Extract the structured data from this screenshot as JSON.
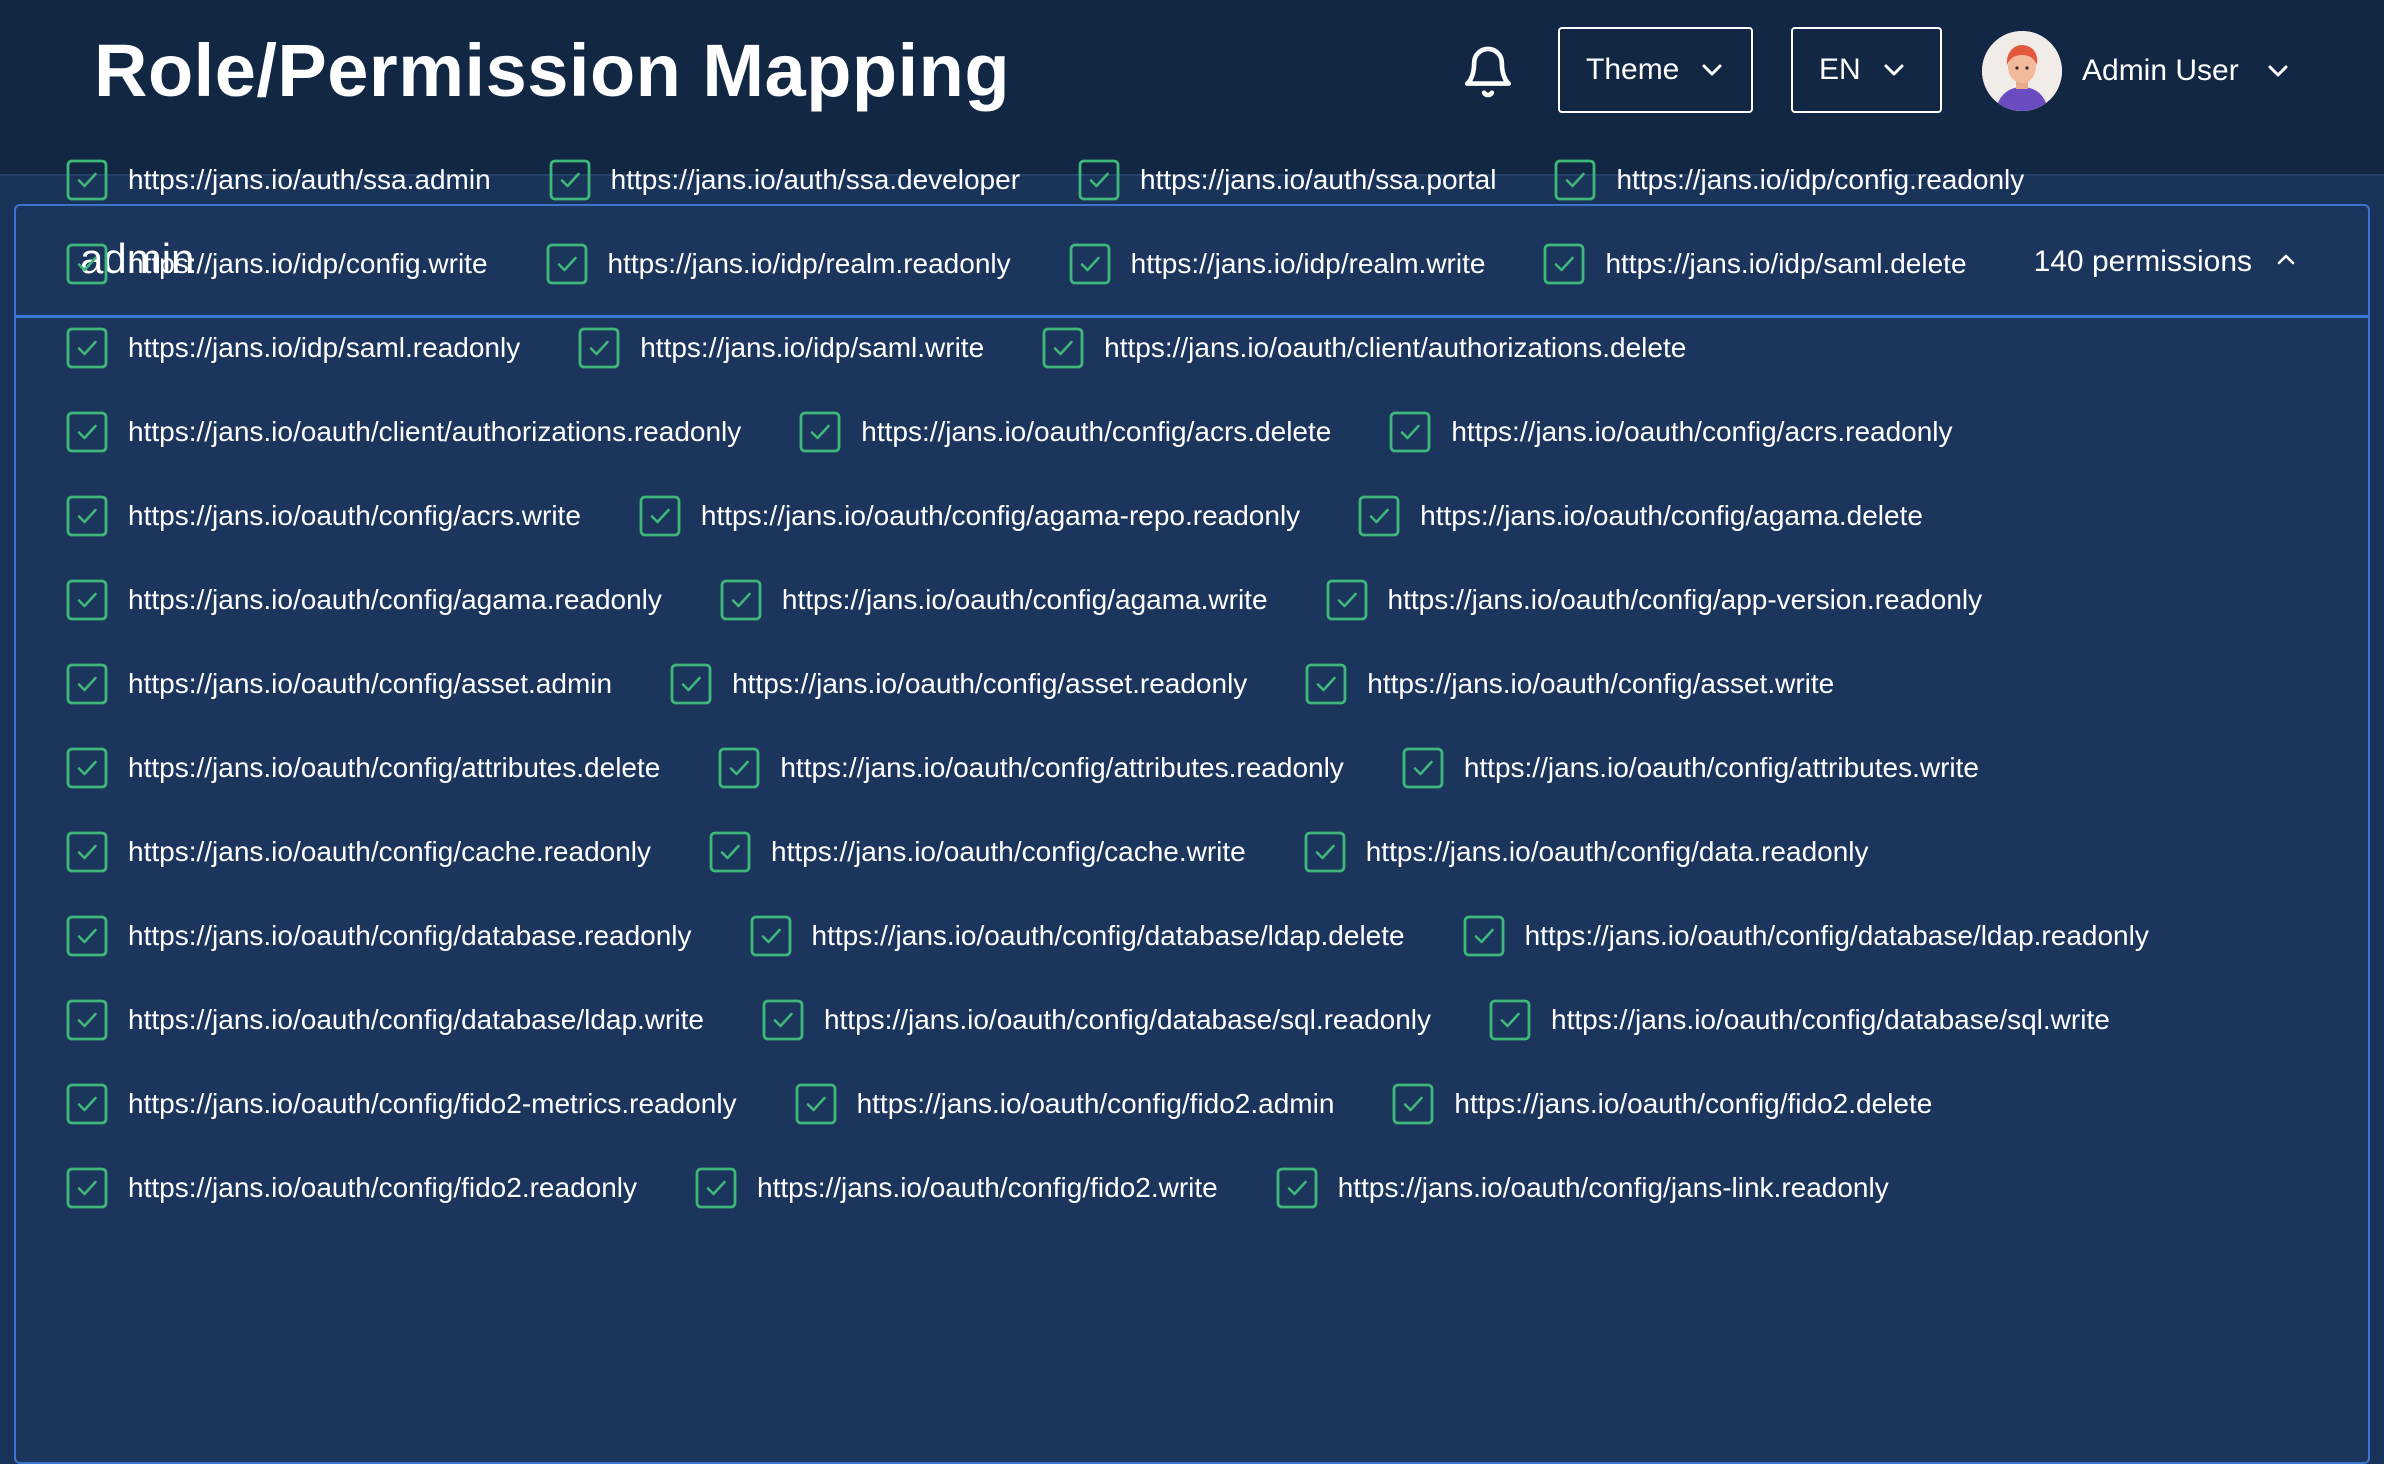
{
  "header": {
    "title": "Role/Permission Mapping",
    "theme_label": "Theme",
    "lang_label": "EN",
    "user_name": "Admin User"
  },
  "role": {
    "name": "admin",
    "permission_count": "140 permissions"
  },
  "colors": {
    "header_bg": "#122744",
    "page_bg": "#1a3359",
    "accent": "#3c78d8",
    "check": "#3fb77a"
  },
  "icons": {
    "bell": "bell-icon",
    "chevron_down": "chevron-down-icon",
    "chevron_up": "chevron-up-icon",
    "checkbox": "checkbox-checked-icon",
    "avatar": "avatar"
  },
  "permission_rows": [
    [
      "https://jans.io/auth/ssa.admin",
      "https://jans.io/auth/ssa.developer",
      "https://jans.io/auth/ssa.portal",
      "https://jans.io/idp/config.readonly"
    ],
    [
      "https://jans.io/idp/config.write",
      "https://jans.io/idp/realm.readonly",
      "https://jans.io/idp/realm.write",
      "https://jans.io/idp/saml.delete"
    ],
    [
      "https://jans.io/idp/saml.readonly",
      "https://jans.io/idp/saml.write",
      "https://jans.io/oauth/client/authorizations.delete"
    ],
    [
      "https://jans.io/oauth/client/authorizations.readonly",
      "https://jans.io/oauth/config/acrs.delete",
      "https://jans.io/oauth/config/acrs.readonly"
    ],
    [
      "https://jans.io/oauth/config/acrs.write",
      "https://jans.io/oauth/config/agama-repo.readonly",
      "https://jans.io/oauth/config/agama.delete"
    ],
    [
      "https://jans.io/oauth/config/agama.readonly",
      "https://jans.io/oauth/config/agama.write",
      "https://jans.io/oauth/config/app-version.readonly"
    ],
    [
      "https://jans.io/oauth/config/asset.admin",
      "https://jans.io/oauth/config/asset.readonly",
      "https://jans.io/oauth/config/asset.write"
    ],
    [
      "https://jans.io/oauth/config/attributes.delete",
      "https://jans.io/oauth/config/attributes.readonly",
      "https://jans.io/oauth/config/attributes.write"
    ],
    [
      "https://jans.io/oauth/config/cache.readonly",
      "https://jans.io/oauth/config/cache.write",
      "https://jans.io/oauth/config/data.readonly"
    ],
    [
      "https://jans.io/oauth/config/database.readonly",
      "https://jans.io/oauth/config/database/ldap.delete",
      "https://jans.io/oauth/config/database/ldap.readonly"
    ],
    [
      "https://jans.io/oauth/config/database/ldap.write",
      "https://jans.io/oauth/config/database/sql.readonly",
      "https://jans.io/oauth/config/database/sql.write"
    ],
    [
      "https://jans.io/oauth/config/fido2-metrics.readonly",
      "https://jans.io/oauth/config/fido2.admin",
      "https://jans.io/oauth/config/fido2.delete"
    ],
    [
      "https://jans.io/oauth/config/fido2.readonly",
      "https://jans.io/oauth/config/fido2.write",
      "https://jans.io/oauth/config/jans-link.readonly"
    ]
  ]
}
